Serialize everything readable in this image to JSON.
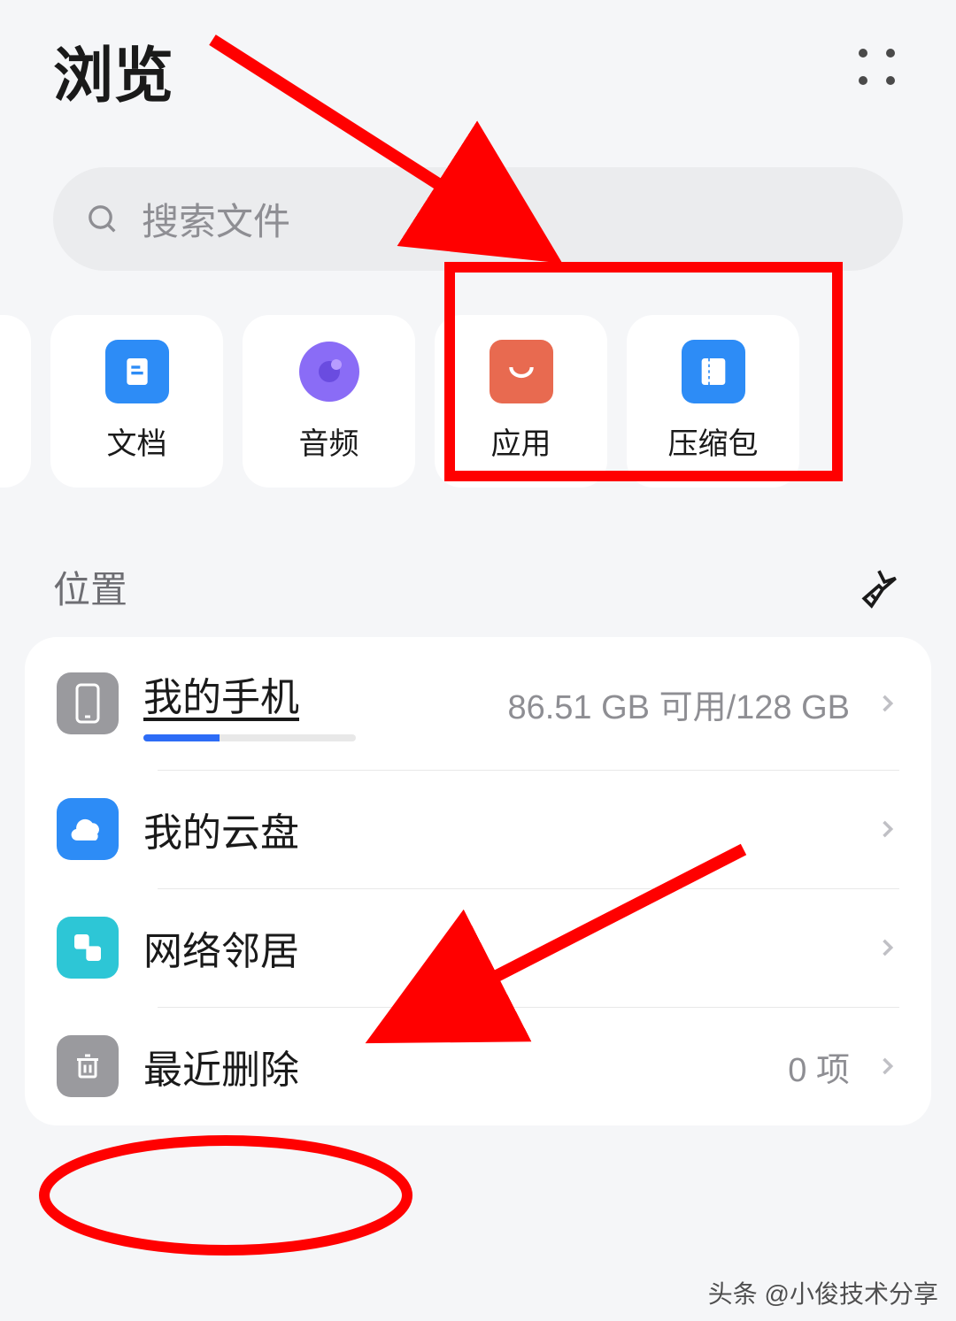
{
  "header": {
    "title": "浏览"
  },
  "search": {
    "placeholder": "搜索文件"
  },
  "categories": [
    {
      "label": "文档",
      "icon": "doc"
    },
    {
      "label": "音频",
      "icon": "audio"
    },
    {
      "label": "应用",
      "icon": "app"
    },
    {
      "label": "压缩包",
      "icon": "zip"
    }
  ],
  "section": {
    "title": "位置"
  },
  "locations": [
    {
      "title": "我的手机",
      "meta": "86.51 GB 可用/128 GB",
      "icon": "phone",
      "progress": true
    },
    {
      "title": "我的云盘",
      "meta": "",
      "icon": "cloud"
    },
    {
      "title": "网络邻居",
      "meta": "",
      "icon": "network"
    },
    {
      "title": "最近删除",
      "meta": "0 项",
      "icon": "trash"
    }
  ],
  "watermark": "头条 @小俊技术分享"
}
